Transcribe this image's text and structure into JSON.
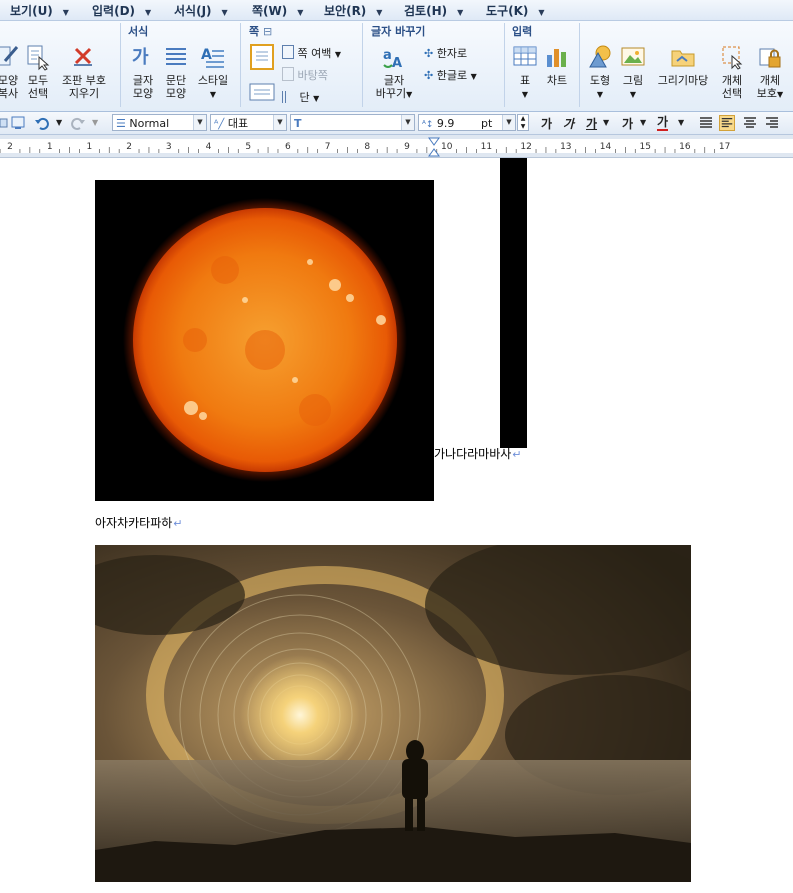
{
  "menu": [
    {
      "label": "보기(U)"
    },
    {
      "label": "입력(D)"
    },
    {
      "label": "서식(J)"
    },
    {
      "label": "쪽(W)"
    },
    {
      "label": "보안(R)"
    },
    {
      "label": "검토(H)"
    },
    {
      "label": "도구(K)"
    }
  ],
  "ribbon": {
    "edit": {
      "copy_shape_l1": "모양",
      "copy_shape_l2": "복사",
      "select_all_l1": "모두",
      "select_all_l2": "선택",
      "clear_marks_l1": "조판 부호",
      "clear_marks_l2": "지우기"
    },
    "format": {
      "title": "서식",
      "char_shape_l1": "글자",
      "char_shape_l2": "모양",
      "para_shape_l1": "문단",
      "para_shape_l2": "모양",
      "style_label": "스타일"
    },
    "page": {
      "title": "쪽",
      "margin_label": "쪽 여백",
      "background_label": "바탕쪽",
      "column_label": "단"
    },
    "convert": {
      "title": "글자 바꾸기",
      "convert_l1": "글자",
      "convert_l2": "바꾸기",
      "hanja_label": "한자로",
      "hangul_label": "한글로"
    },
    "insert": {
      "title": "입력",
      "table_label": "표",
      "chart_label": "차트",
      "shape_label": "도형",
      "picture_label": "그림",
      "picture_market_label": "그리기마당",
      "obj_select_l1": "개체",
      "obj_select_l2": "선택",
      "obj_protect_l1": "개체",
      "obj_protect_l2": "보호"
    }
  },
  "format_bar": {
    "style_value": "Normal",
    "lang_value": "대표",
    "font_value": "",
    "size_value": "9.9",
    "size_unit": "pt",
    "bold": "가",
    "italic": "가",
    "underline": "가",
    "strike": "가",
    "color": "가"
  },
  "ruler": {
    "labels": [
      "2",
      "1",
      "1",
      "2",
      "3",
      "4",
      "5",
      "6",
      "7",
      "8",
      "9",
      "10",
      "11",
      "12",
      "13",
      "14",
      "15",
      "16",
      "17"
    ]
  },
  "document": {
    "line1": "가나다라마바사",
    "line2": "아자차카타파하"
  },
  "colors": {
    "ribbon_title": "#2b4f86",
    "sun_core": "#f07a10",
    "portal_glow": "#f5d27a"
  }
}
